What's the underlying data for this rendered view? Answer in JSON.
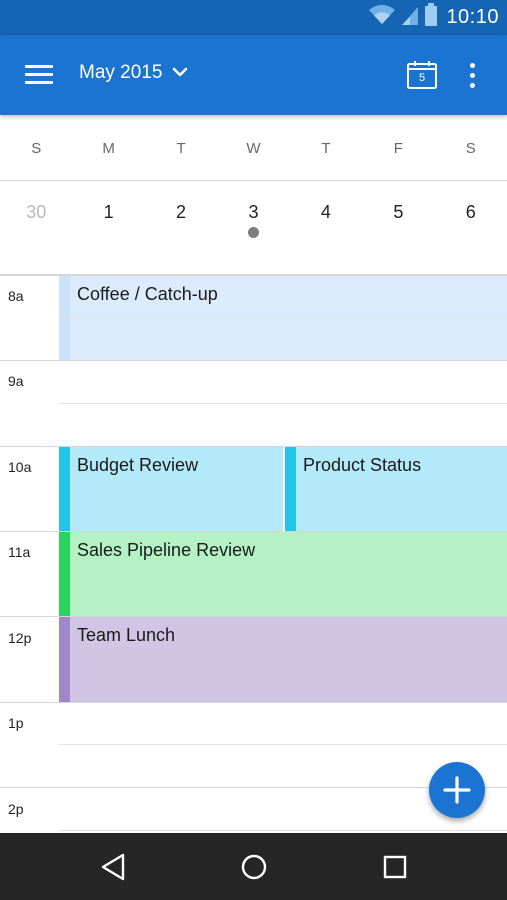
{
  "status_bar": {
    "time": "10:10",
    "icons": [
      "wifi-icon",
      "signal-icon",
      "battery-icon"
    ]
  },
  "app_bar": {
    "menu_icon": "hamburger-menu-icon",
    "month_label": "May 2015",
    "dropdown_icon": "chevron-down-icon",
    "today_day": "5",
    "today_icon": "calendar-today-icon",
    "overflow_icon": "more-vertical-icon"
  },
  "week": {
    "weekdays": [
      "S",
      "M",
      "T",
      "W",
      "T",
      "F",
      "S"
    ],
    "dates": [
      "30",
      "1",
      "2",
      "3",
      "4",
      "5",
      "6"
    ]
  },
  "agenda": {
    "hours": [
      "8a",
      "9a",
      "10a",
      "11a",
      "12p",
      "1p",
      "2p"
    ],
    "events": [
      {
        "title": "Coffee / Catch-up",
        "bar_color": "#cde2f8",
        "bg_color": "#dcebfc"
      },
      {
        "title": "Budget Review",
        "bar_color": "#22c4ea",
        "bg_color": "#b3e9f8"
      },
      {
        "title": "Product Status",
        "bar_color": "#22c4ea",
        "bg_color": "#b3e9f8"
      },
      {
        "title": "Sales Pipeline Review",
        "bar_color": "#2ad45a",
        "bg_color": "#b4f1c5"
      },
      {
        "title": "Team Lunch",
        "bar_color": "#a186ca",
        "bg_color": "#d0c5e5"
      }
    ]
  },
  "fab": {
    "icon": "plus-icon"
  },
  "nav_bar": {
    "icons": [
      "back-icon",
      "home-icon",
      "recents-icon"
    ]
  },
  "colors": {
    "status_bar": "#1664b4",
    "app_bar": "#1b73d2",
    "nav_bar": "#262626",
    "event_dot": "#7c7c7c"
  }
}
